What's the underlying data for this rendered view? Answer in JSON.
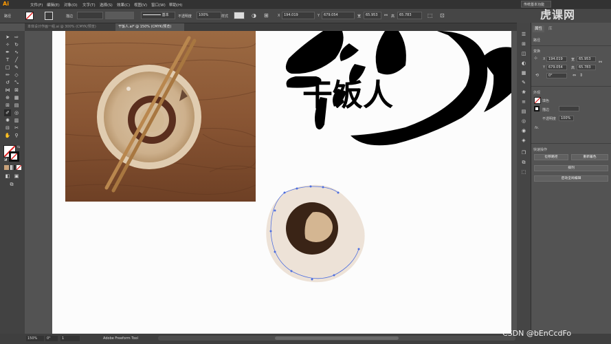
{
  "app": {
    "logo": "Ai",
    "workspace": "传统基本功能"
  },
  "menu": [
    "文件(F)",
    "编辑(E)",
    "对象(O)",
    "文字(T)",
    "选择(S)",
    "效果(C)",
    "视图(V)",
    "窗口(W)",
    "帮助(H)"
  ],
  "control_bar": {
    "path_label": "路径",
    "stroke_label": "描边",
    "stroke_style": "基本",
    "opacity_label": "不透明度",
    "opacity_value": "100%",
    "style_label": "样式",
    "x_label": "X",
    "x_value": "194.019",
    "y_label": "Y",
    "y_value": "679.054",
    "w_label": "宽",
    "w_value": "65.953",
    "h_label": "高",
    "h_value": "65.783"
  },
  "tabs": [
    {
      "label": "本体设计作画一组.ai @ 300% (CMYK/预览)",
      "active": false
    },
    {
      "label": "干饭人.ai* @ 150% (CMYK/预览)",
      "active": true
    }
  ],
  "artwork": {
    "calligraphy": "干饭人"
  },
  "panel": {
    "tabs": [
      "属性",
      "库"
    ],
    "path_label": "路径",
    "transform_label": "变换",
    "x_label": "X",
    "x_value": "194.019",
    "y_label": "Y",
    "y_value": "679.054",
    "w_label": "宽",
    "w_value": "65.953",
    "h_label": "高",
    "h_value": "65.783",
    "angle_value": "0°",
    "appearance_label": "外观",
    "fill_label": "填色",
    "stroke_label": "描边",
    "opacity_label": "不透明度",
    "opacity_value": "100%",
    "fx_label": "fx.",
    "quick_actions_label": "快速操作",
    "btn_offset_path": "位移路径",
    "btn_recolor": "重新着色",
    "btn_arrange": "排列",
    "btn_live_trace": "启动全局编辑"
  },
  "status": {
    "zoom": "150%",
    "angle": "0°",
    "artboard": "1",
    "tool": "Adobe Freeform Tool"
  },
  "watermarks": {
    "top_right": "虎课网",
    "bottom_right": "CSDN @bEnCcdFo"
  },
  "colors": {
    "accent": "#ff9a00",
    "bowl_bg": "#ede2d7",
    "bowl_dark": "#3a2416",
    "bowl_light": "#d4b692",
    "selection": "#4d6ee0"
  }
}
